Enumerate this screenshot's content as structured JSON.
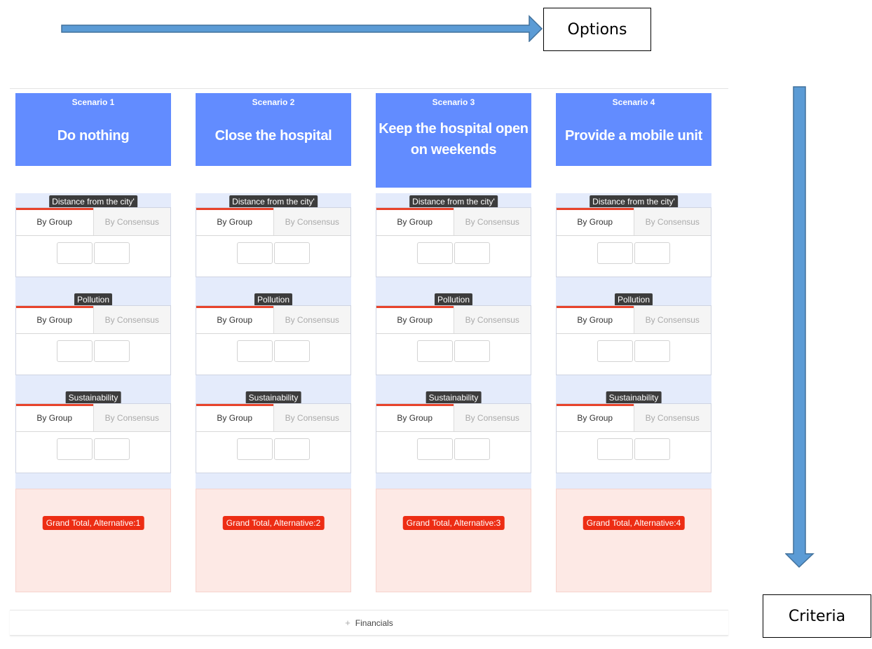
{
  "annotations": {
    "options_label": "Options",
    "criteria_label": "Criteria",
    "arrow_color": "#5b9bd5"
  },
  "scenarios": [
    {
      "number": "Scenario 1",
      "title": "Do nothing",
      "total": "Grand Total, Alternative:1"
    },
    {
      "number": "Scenario 2",
      "title": "Close the hospital",
      "total": "Grand Total, Alternative:2"
    },
    {
      "number": "Scenario 3",
      "title": "Keep the hospital open on weekends",
      "total": "Grand Total, Alternative:3"
    },
    {
      "number": "Scenario 4",
      "title": "Provide a mobile unit",
      "total": "Grand Total, Alternative:4"
    }
  ],
  "criteria": [
    "Distance from the city'",
    "Pollution",
    "Sustainability"
  ],
  "tabs": {
    "group": "By Group",
    "consensus": "By Consensus"
  },
  "footer": {
    "financials_label": "Financials",
    "plus_icon": "+"
  },
  "colors": {
    "header_bg": "#628cff",
    "criteria_bg": "#e4ebfb",
    "total_bg": "#fde9e5",
    "badge": "#ed2d14",
    "active_tab_bar": "#e8432b"
  }
}
